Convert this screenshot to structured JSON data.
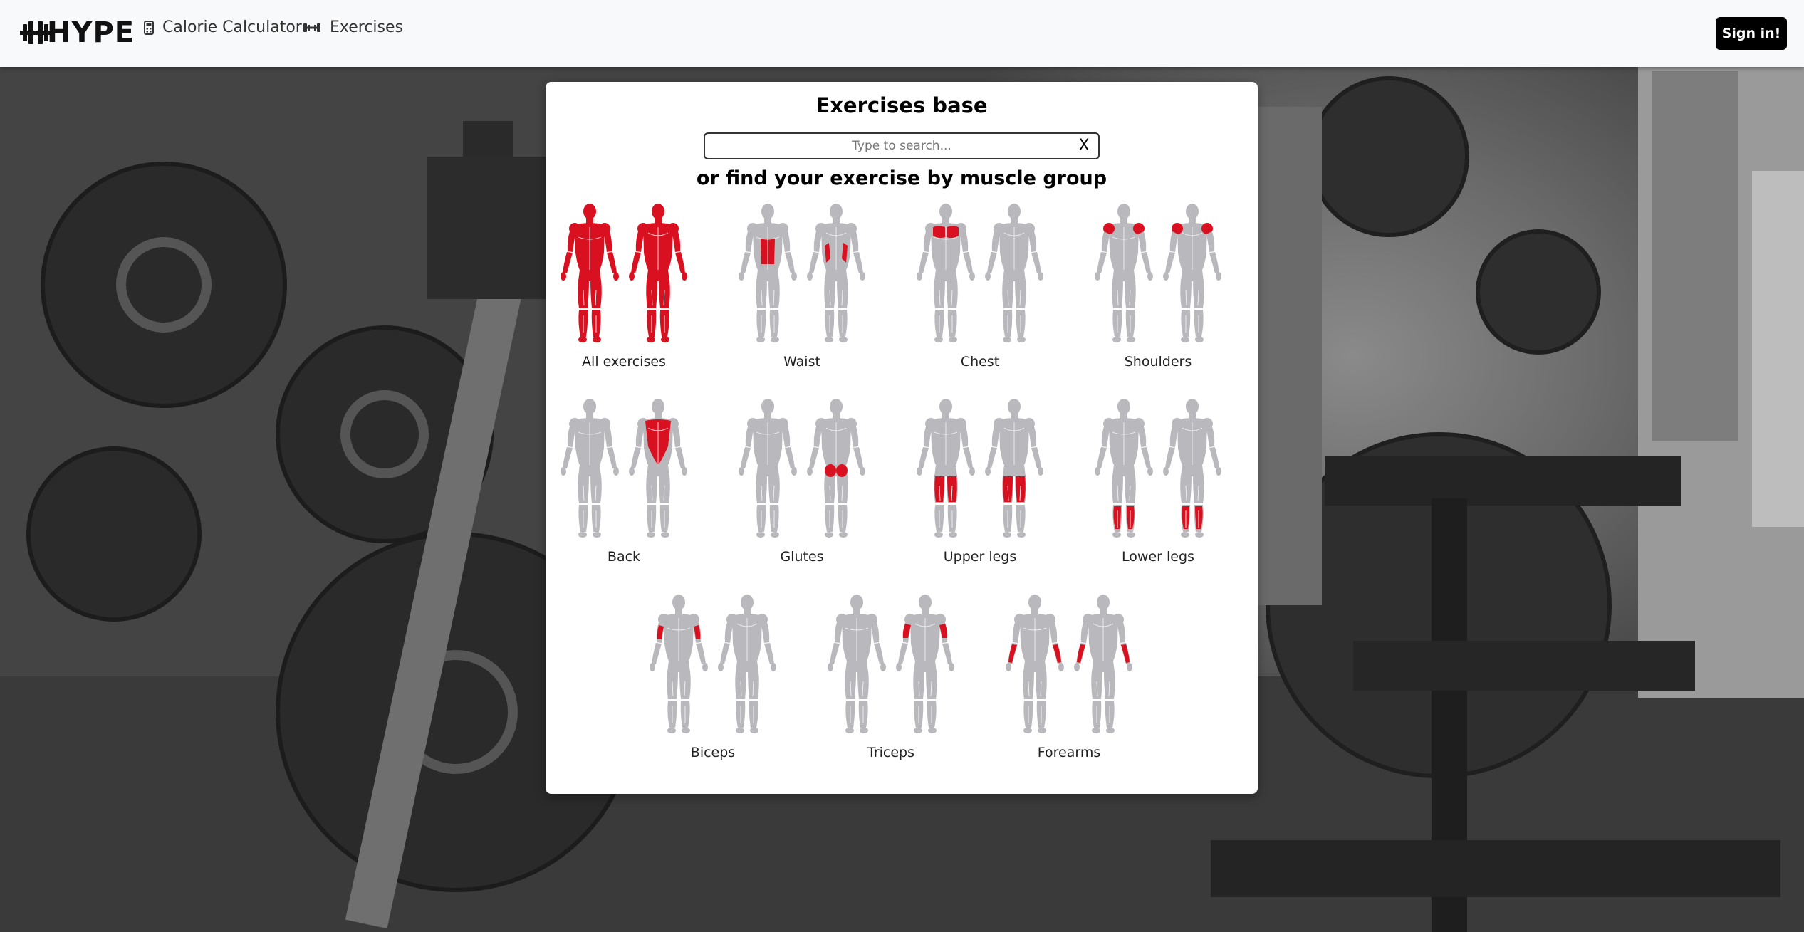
{
  "header": {
    "logo": "HYPE",
    "nav": [
      {
        "label": "Calorie Calculator",
        "icon": "calculator-icon"
      },
      {
        "label": "Exercises",
        "icon": "dumbbell-icon"
      }
    ],
    "sign_in_label": "Sign in!"
  },
  "main": {
    "title": "Exercises base",
    "search": {
      "placeholder": "Type to search...",
      "value": "",
      "clear_label": "X"
    },
    "subtitle": "or find your exercise by muscle group",
    "groups": [
      {
        "label": "All exercises"
      },
      {
        "label": "Waist"
      },
      {
        "label": "Chest"
      },
      {
        "label": "Shoulders"
      },
      {
        "label": "Back"
      },
      {
        "label": "Glutes"
      },
      {
        "label": "Upper legs"
      },
      {
        "label": "Lower legs"
      },
      {
        "label": "Biceps"
      },
      {
        "label": "Triceps"
      },
      {
        "label": "Forearms"
      }
    ]
  },
  "colors": {
    "highlight": "#d9101f",
    "body": "#b9b9bd",
    "body_line": "#f2f2f2"
  }
}
